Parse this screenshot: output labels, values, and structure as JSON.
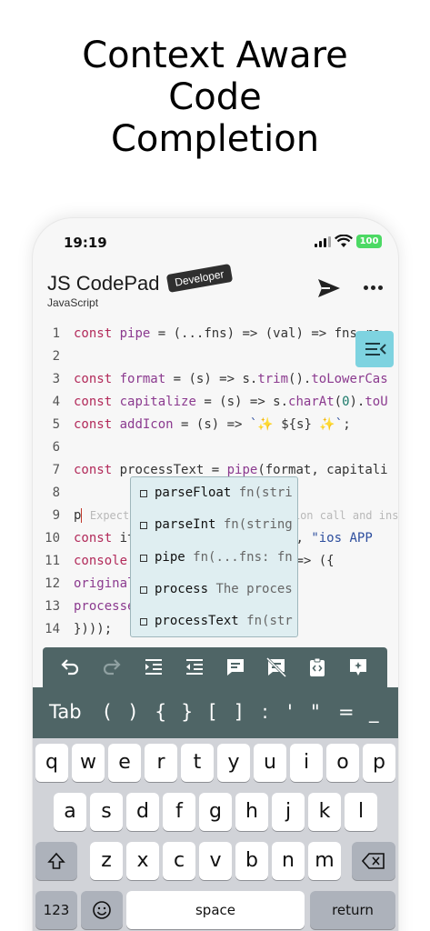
{
  "headline": [
    "Context Aware",
    "Code",
    "Completion"
  ],
  "status_bar": {
    "time": "19:19",
    "battery": "100"
  },
  "app": {
    "title": "JS CodePad",
    "badge": "Developer",
    "subtitle": "JavaScript"
  },
  "editor": {
    "line_numbers": [
      "1",
      "2",
      "3",
      "4",
      "5",
      "6",
      "7",
      "8",
      "9",
      "10",
      "11",
      "12",
      "13",
      "14"
    ],
    "lines": [
      "const pipe = (...fns) => (val) => fns.re",
      "",
      "const format = (s) => s.trim().toLowerCas",
      "const capitalize = (s) => s.charAt(0).toU",
      "const addIcon = (s) => `✨ ${s} ✨`;",
      "",
      "const processText = pipe(format, capitali",
      "",
      "p Expected an assignment or function call and instea",
      "const items = [\"react NATIVE\", \"ios APP",
      "console.log(items.map((item) => ({",
      "  original: item,",
      "  processed: processText(item),",
      "})));"
    ]
  },
  "autocomplete": [
    {
      "name": "parseFloat",
      "type": "fn(stri"
    },
    {
      "name": "parseInt",
      "type": "fn(string"
    },
    {
      "name": "pipe",
      "type": "fn(...fns: fn"
    },
    {
      "name": "process",
      "type": "The proces"
    },
    {
      "name": "processText",
      "type": "fn(str"
    }
  ],
  "toolbar_icons": [
    "undo-icon",
    "redo-icon",
    "indent-icon",
    "outdent-icon",
    "comment-icon",
    "uncomment-icon",
    "format-code-icon",
    "snippet-icon"
  ],
  "symbols": [
    "Tab",
    "(",
    ")",
    "{",
    "}",
    "[",
    "]",
    ":",
    "'",
    "\"",
    "=",
    "_"
  ],
  "keyboard": {
    "row1": [
      "q",
      "w",
      "e",
      "r",
      "t",
      "y",
      "u",
      "i",
      "o",
      "p"
    ],
    "row2": [
      "a",
      "s",
      "d",
      "f",
      "g",
      "h",
      "j",
      "k",
      "l"
    ],
    "row3": [
      "z",
      "x",
      "c",
      "v",
      "b",
      "n",
      "m"
    ],
    "numbers_label": "123",
    "space_label": "space",
    "return_label": "return"
  },
  "colors": {
    "toolbar": "#4f6566",
    "autocomplete_bg": "#dfeef1",
    "fold_button": "#7ed3e0",
    "keyword": "#b22a5a"
  }
}
